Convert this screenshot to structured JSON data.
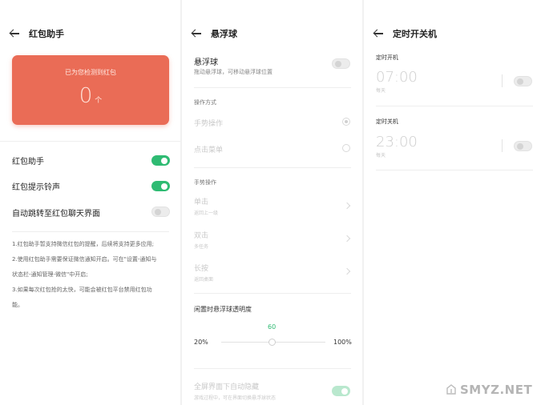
{
  "screen1": {
    "title": "红包助手",
    "card": {
      "detected_text": "已为您检测到红包",
      "count": "0",
      "unit": "个",
      "color": "#ea6c56"
    },
    "rows": [
      {
        "label": "红包助手",
        "on": true
      },
      {
        "label": "红包提示铃声",
        "on": true
      },
      {
        "label": "自动跳转至红包聊天界面",
        "on": false
      }
    ],
    "notes": [
      "1.红包助手暂支持微信红包的提醒，后续将支持更多应用;",
      "2.使用红包助手需要保证微信通知开启。可在\"设置-通知与",
      "状态栏-通知管理-微信\"中开启;",
      "3.如果每次红包抢的太快，可能会被红包平台禁用红包功",
      "能。"
    ]
  },
  "screen2": {
    "title": "悬浮球",
    "float_ball": {
      "label": "悬浮球",
      "desc": "拖动悬浮球，可移动悬浮球位置",
      "on": false
    },
    "mode_section": "操作方式",
    "modes": [
      {
        "label": "手势操作",
        "checked": true
      },
      {
        "label": "点击菜单",
        "checked": false
      }
    ],
    "gesture_section": "手势操作",
    "gestures": [
      {
        "label": "单击",
        "value": "返回上一级"
      },
      {
        "label": "双击",
        "value": "多任务"
      },
      {
        "label": "长按",
        "value": "返回桌面"
      }
    ],
    "opacity": {
      "label": "闲置时悬浮球透明度",
      "value": "60",
      "min": "20%",
      "max": "100%"
    },
    "auto_hide": {
      "label": "全屏界面下自动隐藏",
      "desc": "游戏过程中，可在界面切换悬浮球状态",
      "on": true
    }
  },
  "screen3": {
    "title": "定时开关机",
    "items": [
      {
        "section": "定时开机",
        "time": "07:00",
        "repeat": "每天",
        "on": false
      },
      {
        "section": "定时关机",
        "time": "23:00",
        "repeat": "每天",
        "on": false
      }
    ]
  },
  "watermark": {
    "text": "SMYZ.NET"
  },
  "colors": {
    "accent_green": "#2fbb73",
    "card_red": "#ea6c56"
  }
}
